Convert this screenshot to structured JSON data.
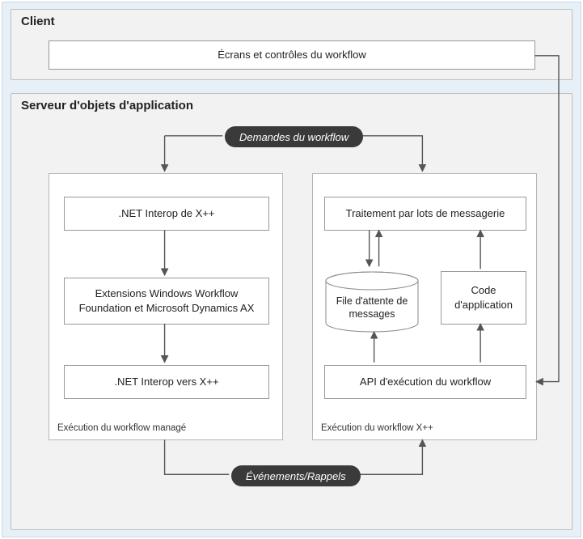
{
  "client": {
    "title": "Client",
    "screens": "Écrans et contrôles du workflow"
  },
  "server": {
    "title": "Serveur d'objets d'application"
  },
  "managed": {
    "label": "Exécution du workflow managé",
    "net_interop_de": ".NET Interop de X++",
    "extensions": "Extensions Windows Workflow Foundation et Microsoft Dynamics AX",
    "net_interop_vers": ".NET Interop vers X++"
  },
  "xpp": {
    "label": "Exécution du workflow X++",
    "batch": "Traitement par lots de messagerie",
    "queue": "File d'attente de messages",
    "appcode": "Code d'application",
    "runtime_api": "API d'exécution du workflow"
  },
  "pills": {
    "requests": "Demandes du workflow",
    "events": "Événements/Rappels"
  }
}
